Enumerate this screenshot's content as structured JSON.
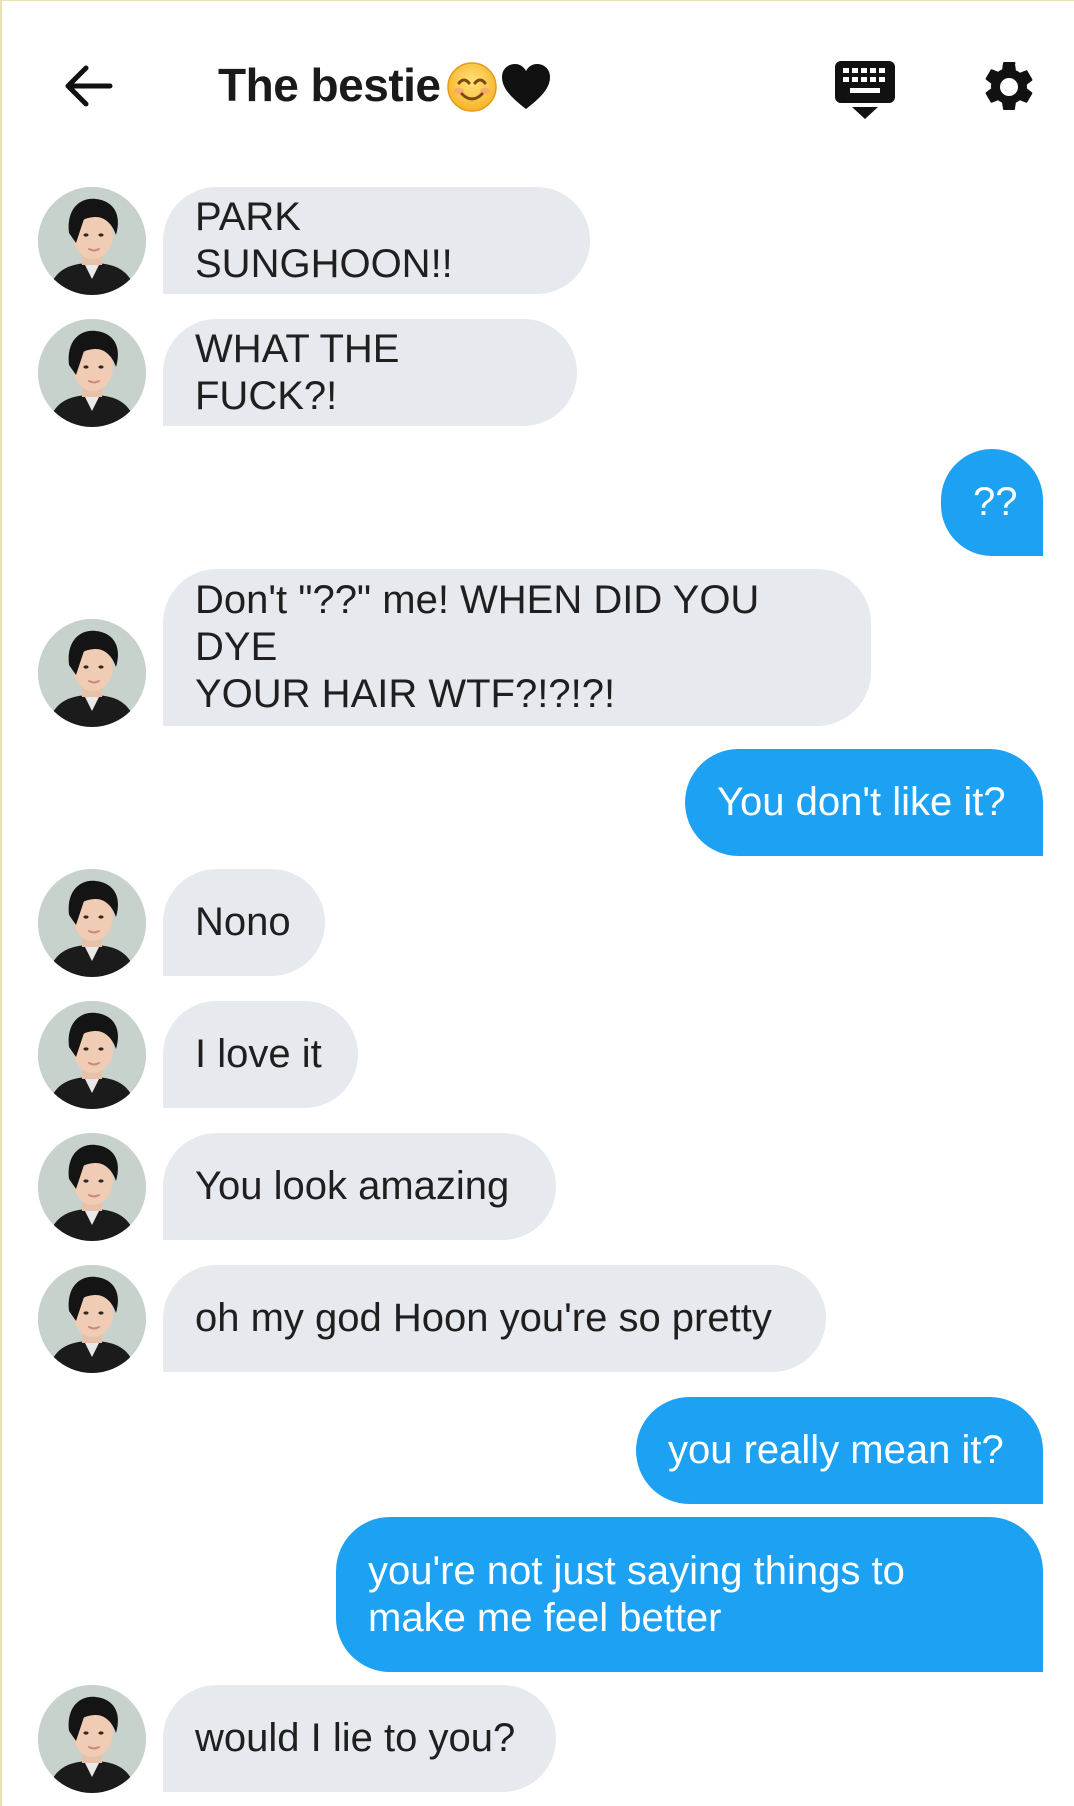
{
  "header": {
    "title": "The bestie",
    "title_emojis": "😊🖤",
    "back_icon": "arrow-left-icon",
    "keyboard_icon": "keyboard-hide-icon",
    "settings_icon": "gear-icon"
  },
  "colors": {
    "outgoing_bubble": "#1da1f2",
    "incoming_bubble": "#e6e9ed",
    "text_dark": "#1f1f1f"
  },
  "messages": [
    {
      "from": "them",
      "text": "PARK SUNGHOON!!"
    },
    {
      "from": "them",
      "text": "WHAT THE FUCK?!"
    },
    {
      "from": "me",
      "text": "??"
    },
    {
      "from": "them",
      "text": "Don't \"??\" me! WHEN DID YOU DYE\nYOUR HAIR WTF?!?!?!"
    },
    {
      "from": "me",
      "text": "You don't like it?"
    },
    {
      "from": "them",
      "text": "Nono"
    },
    {
      "from": "them",
      "text": "I love it"
    },
    {
      "from": "them",
      "text": "You look amazing"
    },
    {
      "from": "them",
      "text": "oh my god Hoon you're so pretty"
    },
    {
      "from": "me",
      "text": "you really mean it?"
    },
    {
      "from": "me",
      "text": "you're not just saying things to\nmake me feel better"
    },
    {
      "from": "them",
      "text": "would I lie to you?"
    }
  ]
}
